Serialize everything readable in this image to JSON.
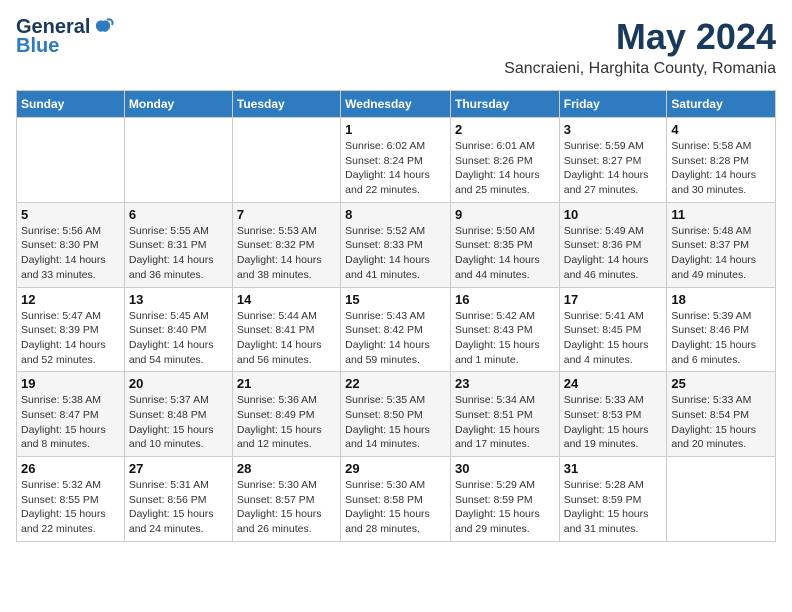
{
  "logo": {
    "line1": "General",
    "line2": "Blue"
  },
  "title": "May 2024",
  "subtitle": "Sancraieni, Harghita County, Romania",
  "weekdays": [
    "Sunday",
    "Monday",
    "Tuesday",
    "Wednesday",
    "Thursday",
    "Friday",
    "Saturday"
  ],
  "weeks": [
    [
      null,
      null,
      null,
      {
        "day": "1",
        "sunrise": "Sunrise: 6:02 AM",
        "sunset": "Sunset: 8:24 PM",
        "daylight": "Daylight: 14 hours and 22 minutes."
      },
      {
        "day": "2",
        "sunrise": "Sunrise: 6:01 AM",
        "sunset": "Sunset: 8:26 PM",
        "daylight": "Daylight: 14 hours and 25 minutes."
      },
      {
        "day": "3",
        "sunrise": "Sunrise: 5:59 AM",
        "sunset": "Sunset: 8:27 PM",
        "daylight": "Daylight: 14 hours and 27 minutes."
      },
      {
        "day": "4",
        "sunrise": "Sunrise: 5:58 AM",
        "sunset": "Sunset: 8:28 PM",
        "daylight": "Daylight: 14 hours and 30 minutes."
      }
    ],
    [
      {
        "day": "5",
        "sunrise": "Sunrise: 5:56 AM",
        "sunset": "Sunset: 8:30 PM",
        "daylight": "Daylight: 14 hours and 33 minutes."
      },
      {
        "day": "6",
        "sunrise": "Sunrise: 5:55 AM",
        "sunset": "Sunset: 8:31 PM",
        "daylight": "Daylight: 14 hours and 36 minutes."
      },
      {
        "day": "7",
        "sunrise": "Sunrise: 5:53 AM",
        "sunset": "Sunset: 8:32 PM",
        "daylight": "Daylight: 14 hours and 38 minutes."
      },
      {
        "day": "8",
        "sunrise": "Sunrise: 5:52 AM",
        "sunset": "Sunset: 8:33 PM",
        "daylight": "Daylight: 14 hours and 41 minutes."
      },
      {
        "day": "9",
        "sunrise": "Sunrise: 5:50 AM",
        "sunset": "Sunset: 8:35 PM",
        "daylight": "Daylight: 14 hours and 44 minutes."
      },
      {
        "day": "10",
        "sunrise": "Sunrise: 5:49 AM",
        "sunset": "Sunset: 8:36 PM",
        "daylight": "Daylight: 14 hours and 46 minutes."
      },
      {
        "day": "11",
        "sunrise": "Sunrise: 5:48 AM",
        "sunset": "Sunset: 8:37 PM",
        "daylight": "Daylight: 14 hours and 49 minutes."
      }
    ],
    [
      {
        "day": "12",
        "sunrise": "Sunrise: 5:47 AM",
        "sunset": "Sunset: 8:39 PM",
        "daylight": "Daylight: 14 hours and 52 minutes."
      },
      {
        "day": "13",
        "sunrise": "Sunrise: 5:45 AM",
        "sunset": "Sunset: 8:40 PM",
        "daylight": "Daylight: 14 hours and 54 minutes."
      },
      {
        "day": "14",
        "sunrise": "Sunrise: 5:44 AM",
        "sunset": "Sunset: 8:41 PM",
        "daylight": "Daylight: 14 hours and 56 minutes."
      },
      {
        "day": "15",
        "sunrise": "Sunrise: 5:43 AM",
        "sunset": "Sunset: 8:42 PM",
        "daylight": "Daylight: 14 hours and 59 minutes."
      },
      {
        "day": "16",
        "sunrise": "Sunrise: 5:42 AM",
        "sunset": "Sunset: 8:43 PM",
        "daylight": "Daylight: 15 hours and 1 minute."
      },
      {
        "day": "17",
        "sunrise": "Sunrise: 5:41 AM",
        "sunset": "Sunset: 8:45 PM",
        "daylight": "Daylight: 15 hours and 4 minutes."
      },
      {
        "day": "18",
        "sunrise": "Sunrise: 5:39 AM",
        "sunset": "Sunset: 8:46 PM",
        "daylight": "Daylight: 15 hours and 6 minutes."
      }
    ],
    [
      {
        "day": "19",
        "sunrise": "Sunrise: 5:38 AM",
        "sunset": "Sunset: 8:47 PM",
        "daylight": "Daylight: 15 hours and 8 minutes."
      },
      {
        "day": "20",
        "sunrise": "Sunrise: 5:37 AM",
        "sunset": "Sunset: 8:48 PM",
        "daylight": "Daylight: 15 hours and 10 minutes."
      },
      {
        "day": "21",
        "sunrise": "Sunrise: 5:36 AM",
        "sunset": "Sunset: 8:49 PM",
        "daylight": "Daylight: 15 hours and 12 minutes."
      },
      {
        "day": "22",
        "sunrise": "Sunrise: 5:35 AM",
        "sunset": "Sunset: 8:50 PM",
        "daylight": "Daylight: 15 hours and 14 minutes."
      },
      {
        "day": "23",
        "sunrise": "Sunrise: 5:34 AM",
        "sunset": "Sunset: 8:51 PM",
        "daylight": "Daylight: 15 hours and 17 minutes."
      },
      {
        "day": "24",
        "sunrise": "Sunrise: 5:33 AM",
        "sunset": "Sunset: 8:53 PM",
        "daylight": "Daylight: 15 hours and 19 minutes."
      },
      {
        "day": "25",
        "sunrise": "Sunrise: 5:33 AM",
        "sunset": "Sunset: 8:54 PM",
        "daylight": "Daylight: 15 hours and 20 minutes."
      }
    ],
    [
      {
        "day": "26",
        "sunrise": "Sunrise: 5:32 AM",
        "sunset": "Sunset: 8:55 PM",
        "daylight": "Daylight: 15 hours and 22 minutes."
      },
      {
        "day": "27",
        "sunrise": "Sunrise: 5:31 AM",
        "sunset": "Sunset: 8:56 PM",
        "daylight": "Daylight: 15 hours and 24 minutes."
      },
      {
        "day": "28",
        "sunrise": "Sunrise: 5:30 AM",
        "sunset": "Sunset: 8:57 PM",
        "daylight": "Daylight: 15 hours and 26 minutes."
      },
      {
        "day": "29",
        "sunrise": "Sunrise: 5:30 AM",
        "sunset": "Sunset: 8:58 PM",
        "daylight": "Daylight: 15 hours and 28 minutes."
      },
      {
        "day": "30",
        "sunrise": "Sunrise: 5:29 AM",
        "sunset": "Sunset: 8:59 PM",
        "daylight": "Daylight: 15 hours and 29 minutes."
      },
      {
        "day": "31",
        "sunrise": "Sunrise: 5:28 AM",
        "sunset": "Sunset: 8:59 PM",
        "daylight": "Daylight: 15 hours and 31 minutes."
      },
      null
    ]
  ]
}
